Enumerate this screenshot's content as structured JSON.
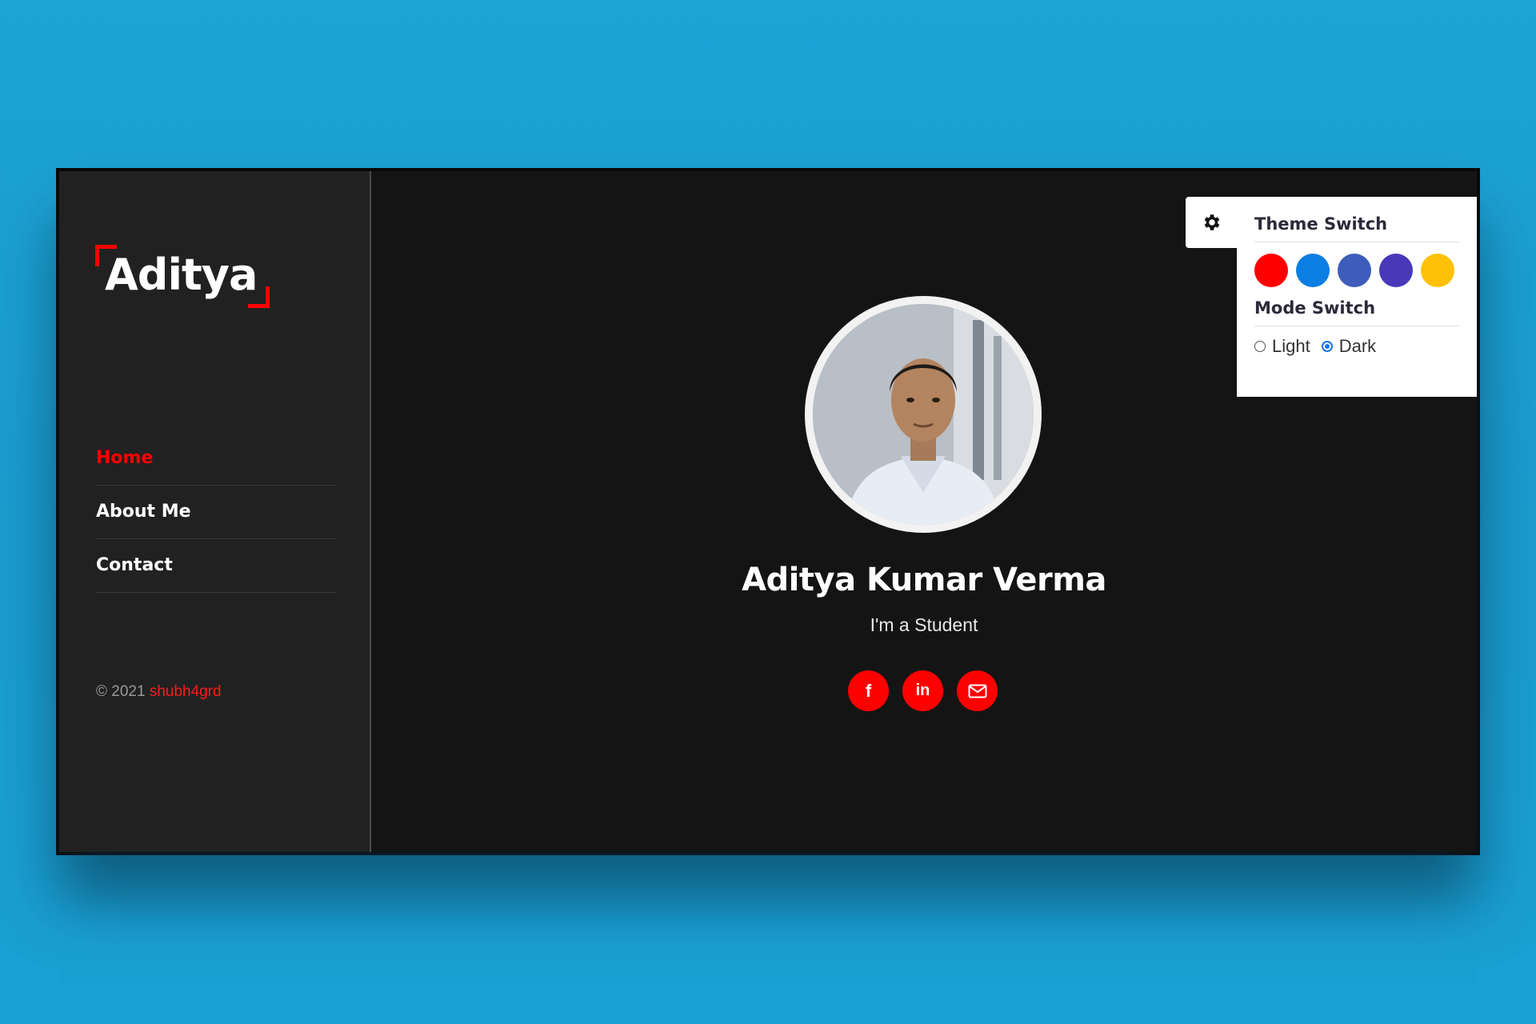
{
  "sidebar": {
    "logo": "Aditya",
    "nav": [
      {
        "label": "Home",
        "active": true
      },
      {
        "label": "About Me",
        "active": false
      },
      {
        "label": "Contact",
        "active": false
      }
    ],
    "copyright_prefix": "© 2021",
    "copyright_author": "shubh4grd"
  },
  "profile": {
    "name": "Aditya Kumar Verma",
    "tagline": "I'm a Student",
    "socials": [
      {
        "icon": "facebook-icon",
        "glyph": "f"
      },
      {
        "icon": "linkedin-icon",
        "glyph": "in"
      },
      {
        "icon": "mail-icon",
        "glyph": "✉"
      }
    ]
  },
  "settings": {
    "gear_icon": "gear-icon",
    "theme_title": "Theme Switch",
    "swatch_colors": [
      "#ff0000",
      "#0b7ee3",
      "#3e5cba",
      "#4938b8",
      "#ffc107"
    ],
    "mode_title": "Mode Switch",
    "modes": [
      {
        "label": "Light",
        "checked": false
      },
      {
        "label": "Dark",
        "checked": true
      }
    ]
  },
  "colors": {
    "accent": "#ff0000",
    "page_background": "#1aa0d4",
    "sidebar_background": "#212121",
    "main_background": "#141414"
  }
}
